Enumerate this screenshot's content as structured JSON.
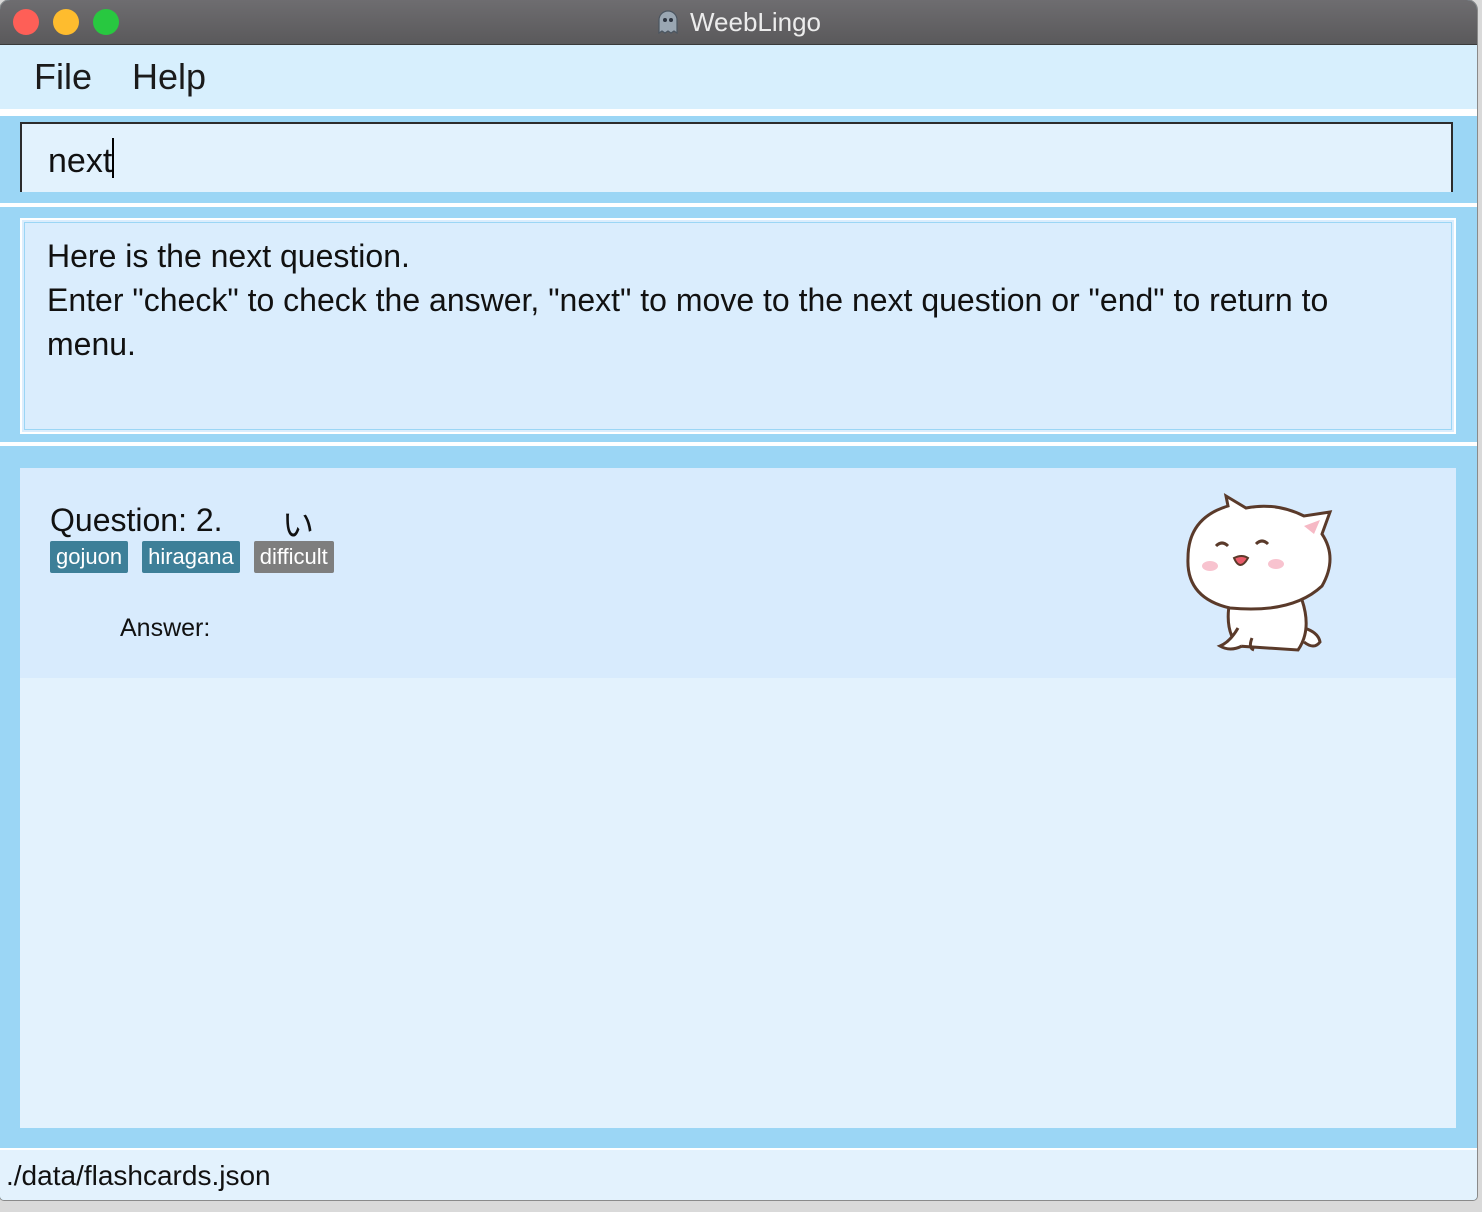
{
  "window": {
    "title": "WeebLingo",
    "app_icon": "ghost-icon"
  },
  "menu": {
    "items": [
      {
        "label": "File"
      },
      {
        "label": "Help"
      }
    ]
  },
  "command": {
    "value": "next"
  },
  "result": {
    "lines": [
      "Here is the next question.",
      "Enter \"check\" to check the answer, \"next\" to move to the next question or \"end\" to return to menu."
    ]
  },
  "card": {
    "question_label": "Question: 2.",
    "question_text": "い",
    "tags": [
      {
        "label": "gojuon",
        "color": "#3d7f98"
      },
      {
        "label": "hiragana",
        "color": "#3d7f98"
      },
      {
        "label": "difficult",
        "color": "#7e7e7e"
      }
    ],
    "answer_label": "Answer:",
    "mascot": "cat-mascot-icon"
  },
  "status": {
    "path": "./data/flashcards.json"
  },
  "colors": {
    "accent": "#9bd6f5",
    "panel": "#e3f2fd",
    "tag_blue": "#3d7f98",
    "tag_grey": "#7e7e7e"
  }
}
